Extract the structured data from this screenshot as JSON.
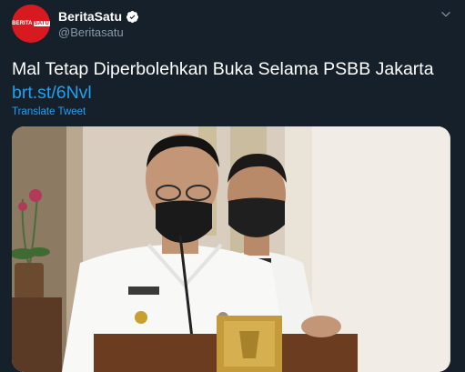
{
  "account": {
    "display_name": "BeritaSatu",
    "handle": "@Beritasatu",
    "verified": true,
    "avatar_logo_text": "BERITASATU",
    "avatar_color": "#d71920"
  },
  "tweet": {
    "text": "Mal Tetap Diperbolehkan Buka Selama PSBB Jakarta",
    "link_text": "brt.st/6Nvl",
    "translate_label": "Translate Tweet"
  },
  "media": {
    "kind": "photo"
  },
  "icons": {
    "verified": "verified-badge-icon",
    "more": "chevron-down-icon"
  },
  "colors": {
    "background": "#15202b",
    "link": "#1da1f2",
    "secondary_text": "#8899a6"
  }
}
